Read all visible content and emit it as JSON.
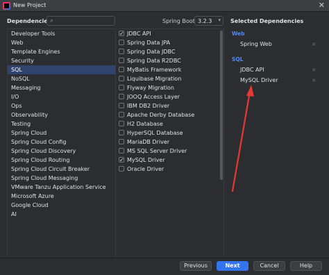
{
  "window": {
    "title": "New Project"
  },
  "header": {
    "dependencies_label": "Dependencies",
    "search_placeholder": "",
    "spring_boot_label": "Spring Boot",
    "spring_boot_version": "3.2.3"
  },
  "categories": [
    {
      "label": "Developer Tools"
    },
    {
      "label": "Web"
    },
    {
      "label": "Template Engines"
    },
    {
      "label": "Security"
    },
    {
      "label": "SQL",
      "selected": true
    },
    {
      "label": "NoSQL"
    },
    {
      "label": "Messaging"
    },
    {
      "label": "I/O"
    },
    {
      "label": "Ops"
    },
    {
      "label": "Observability"
    },
    {
      "label": "Testing"
    },
    {
      "label": "Spring Cloud"
    },
    {
      "label": "Spring Cloud Config"
    },
    {
      "label": "Spring Cloud Discovery"
    },
    {
      "label": "Spring Cloud Routing"
    },
    {
      "label": "Spring Cloud Circuit Breaker"
    },
    {
      "label": "Spring Cloud Messaging"
    },
    {
      "label": "VMware Tanzu Application Service"
    },
    {
      "label": "Microsoft Azure"
    },
    {
      "label": "Google Cloud"
    },
    {
      "label": "AI"
    }
  ],
  "dependencies": [
    {
      "label": "JDBC API",
      "checked": true
    },
    {
      "label": "Spring Data JPA",
      "checked": false
    },
    {
      "label": "Spring Data JDBC",
      "checked": false
    },
    {
      "label": "Spring Data R2DBC",
      "checked": false
    },
    {
      "label": "MyBatis Framework",
      "checked": false
    },
    {
      "label": "Liquibase Migration",
      "checked": false
    },
    {
      "label": "Flyway Migration",
      "checked": false
    },
    {
      "label": "JOOQ Access Layer",
      "checked": false
    },
    {
      "label": "IBM DB2 Driver",
      "checked": false
    },
    {
      "label": "Apache Derby Database",
      "checked": false
    },
    {
      "label": "H2 Database",
      "checked": false
    },
    {
      "label": "HyperSQL Database",
      "checked": false
    },
    {
      "label": "MariaDB Driver",
      "checked": false
    },
    {
      "label": "MS SQL Server Driver",
      "checked": false
    },
    {
      "label": "MySQL Driver",
      "checked": true
    },
    {
      "label": "Oracle Driver",
      "checked": false
    }
  ],
  "selected": {
    "title": "Selected Dependencies",
    "groups": [
      {
        "name": "Web",
        "items": [
          "Spring Web"
        ]
      },
      {
        "name": "SQL",
        "items": [
          "JDBC API",
          "MySQL Driver"
        ]
      }
    ],
    "remove_glyph": "×"
  },
  "footer": {
    "previous": "Previous",
    "next": "Next",
    "cancel": "Cancel",
    "help": "Help"
  },
  "colors": {
    "background": "#2b2d30",
    "selection": "#2e436e",
    "accent": "#548af7",
    "primary_button": "#3574f0",
    "annotation_arrow": "#e53935"
  },
  "icons": {
    "app": "intellij-logo-icon",
    "close": "close-icon",
    "search": "search-icon",
    "dropdown": "chevron-down-icon",
    "remove": "remove-icon"
  }
}
